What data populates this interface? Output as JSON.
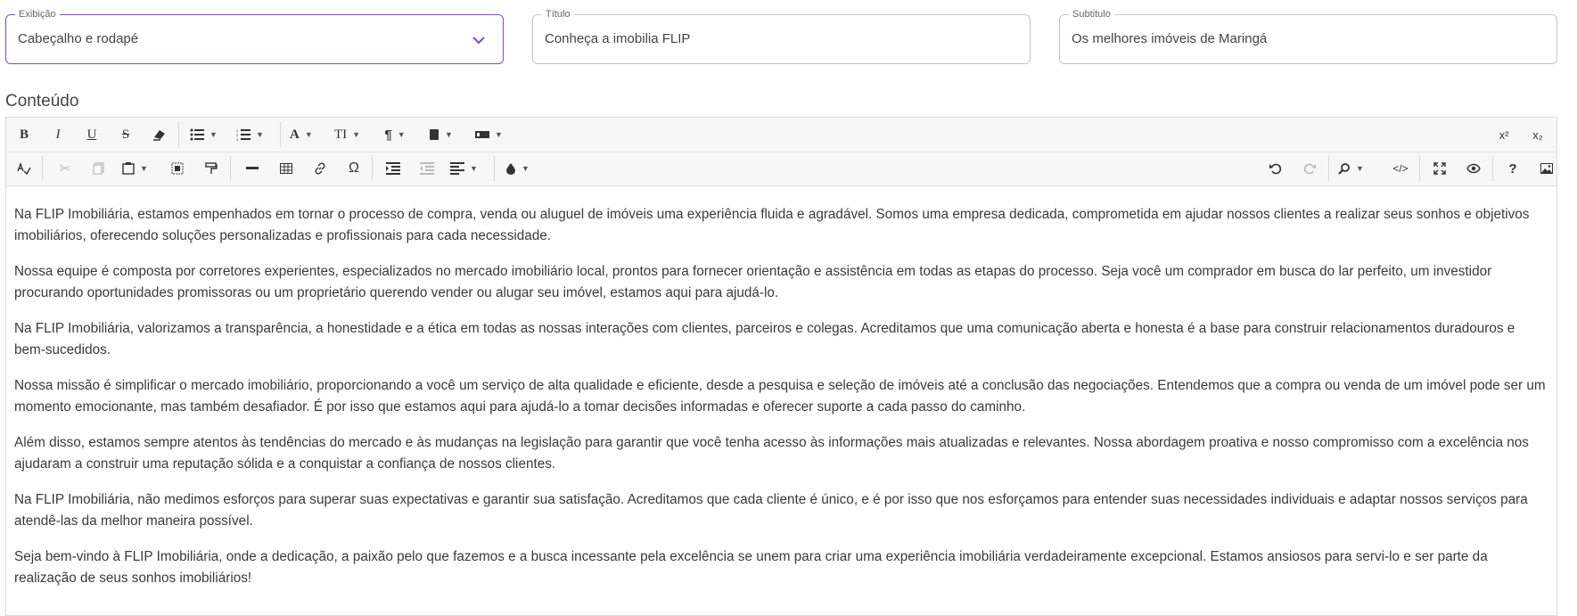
{
  "fields": {
    "exibicao": {
      "label": "Exibição",
      "value": "Cabeçalho e rodapé"
    },
    "titulo": {
      "label": "Título",
      "value": "Conheça a imobilia FLIP"
    },
    "subtitulo": {
      "label": "Subtitulo",
      "value": "Os melhores imóveis de Maringá"
    }
  },
  "editor": {
    "section_title": "Conteúdo",
    "toolbar": {
      "row1_left": [
        {
          "name": "bold-button",
          "glyph": "B"
        },
        {
          "name": "italic-button",
          "glyph": "I"
        },
        {
          "name": "underline-button",
          "glyph": "U"
        },
        {
          "name": "strikethrough-button",
          "glyph": "S"
        },
        {
          "name": "eraser-button",
          "glyph": "⌫"
        },
        {
          "name": "bulleted-list-button",
          "glyph": "☰"
        },
        {
          "name": "numbered-list-button",
          "glyph": "≡"
        },
        {
          "name": "font-button",
          "glyph": "A"
        },
        {
          "name": "font-size-button",
          "glyph": "TI"
        },
        {
          "name": "paragraph-button",
          "glyph": "¶"
        },
        {
          "name": "class-button",
          "glyph": "■"
        },
        {
          "name": "blocks-button",
          "glyph": "▬"
        }
      ],
      "superscript": "x²",
      "subscript": "x₂"
    },
    "paragraphs": [
      "Na FLIP Imobiliária, estamos empenhados em tornar o processo de compra, venda ou aluguel de imóveis uma experiência fluida e agradável. Somos uma empresa dedicada, comprometida em ajudar nossos clientes a realizar seus sonhos e objetivos imobiliários, oferecendo soluções personalizadas e profissionais para cada necessidade.",
      "Nossa equipe é composta por corretores experientes, especializados no mercado imobiliário local, prontos para fornecer orientação e assistência em todas as etapas do processo. Seja você um comprador em busca do lar perfeito, um investidor procurando oportunidades promissoras ou um proprietário querendo vender ou alugar seu imóvel, estamos aqui para ajudá-lo.",
      "Na FLIP Imobiliária, valorizamos a transparência, a honestidade e a ética em todas as nossas interações com clientes, parceiros e colegas. Acreditamos que uma comunicação aberta e honesta é a base para construir relacionamentos duradouros e bem-sucedidos.",
      "Nossa missão é simplificar o mercado imobiliário, proporcionando a você um serviço de alta qualidade e eficiente, desde a pesquisa e seleção de imóveis até a conclusão das negociações. Entendemos que a compra ou venda de um imóvel pode ser um momento emocionante, mas também desafiador. É por isso que estamos aqui para ajudá-lo a tomar decisões informadas e oferecer suporte a cada passo do caminho.",
      "Além disso, estamos sempre atentos às tendências do mercado e às mudanças na legislação para garantir que você tenha acesso às informações mais atualizadas e relevantes. Nossa abordagem proativa e nosso compromisso com a excelência nos ajudaram a construir uma reputação sólida e a conquistar a confiança de nossos clientes.",
      "Na FLIP Imobiliária, não medimos esforços para superar suas expectativas e garantir sua satisfação. Acreditamos que cada cliente é único, e é por isso que nos esforçamos para entender suas necessidades individuais e adaptar nossos serviços para atendê-las da melhor maneira possível.",
      "Seja bem-vindo à FLIP Imobiliária, onde a dedicação, a paixão pelo que fazemos e a busca incessante pela excelência se unem para criar uma experiência imobiliária verdadeiramente excepcional. Estamos ansiosos para servi-lo e ser parte da realização de seus sonhos imobiliários!"
    ]
  },
  "colors": {
    "accent": "#7c4dcc",
    "border": "#c4c4c4"
  }
}
